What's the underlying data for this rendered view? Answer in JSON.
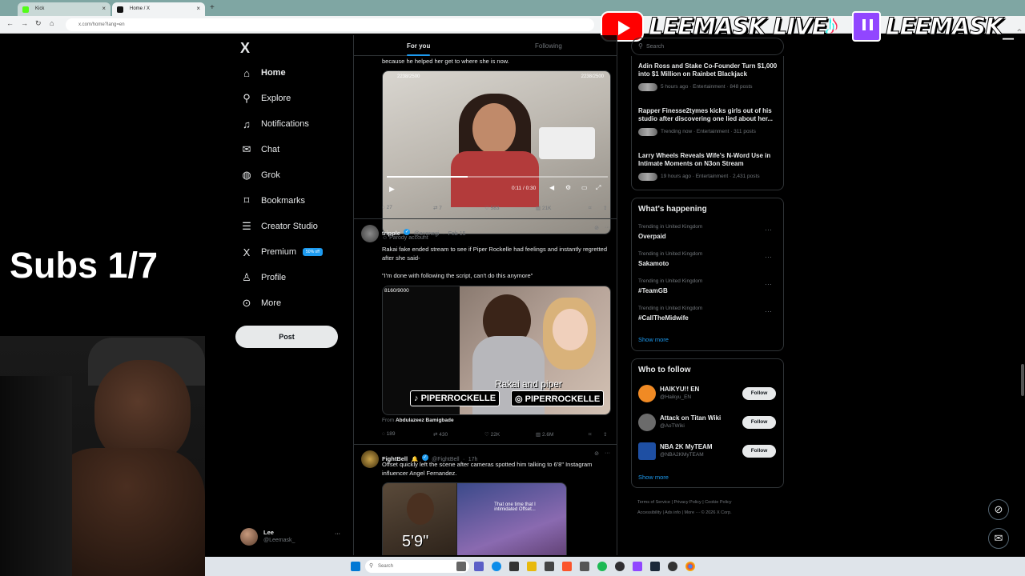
{
  "browser": {
    "tabs": [
      "Kick",
      "Home / X"
    ],
    "url": "x.com/home?lang=en"
  },
  "banner": {
    "live_text": "LEEMASK LIVE",
    "channel_text": "LEEMASK_"
  },
  "overlay": {
    "subs_text": "Subs 1/7"
  },
  "nav": {
    "logo": "X",
    "items": [
      {
        "label": "Home",
        "icon": "home-icon",
        "glyph": "⌂"
      },
      {
        "label": "Explore",
        "icon": "search-icon",
        "glyph": "⚲"
      },
      {
        "label": "Notifications",
        "icon": "bell-icon",
        "glyph": "♫"
      },
      {
        "label": "Chat",
        "icon": "mail-icon",
        "glyph": "✉"
      },
      {
        "label": "Grok",
        "icon": "grok-icon",
        "glyph": "◍"
      },
      {
        "label": "Bookmarks",
        "icon": "bookmark-icon",
        "glyph": "⌑"
      },
      {
        "label": "Creator Studio",
        "icon": "creator-studio-icon",
        "glyph": "☰"
      },
      {
        "label": "Premium",
        "icon": "x-premium-icon",
        "glyph": "X"
      },
      {
        "label": "Profile",
        "icon": "person-icon",
        "glyph": "♙"
      },
      {
        "label": "More",
        "icon": "more-circle-icon",
        "glyph": "⊙"
      }
    ],
    "premium_badge": "50% off",
    "post_label": "Post",
    "account": {
      "name": "Lee",
      "handle": "@Leemask_",
      "more": "···"
    }
  },
  "feed": {
    "tabs": [
      "For you",
      "Following"
    ],
    "post1": {
      "text": "because he helped her get to where she is now.",
      "video_counter": "2238/2500",
      "video_time": "0:11 / 0:30",
      "stats": {
        "replies": "27",
        "reposts": "7",
        "likes": "583",
        "views": "21K"
      }
    },
    "post2": {
      "name": "tripple",
      "handle": "@ayonegi",
      "date": "Feb 15",
      "parody": "Parody account",
      "text": "Rakai fake ended stream to see if Piper Rockelle had feelings and instantly regretted after she said-",
      "quote": "\"I'm done with following the script, can't do this anymore\"",
      "media_counter": "8160/9000",
      "media_caption": "Rakai and piper",
      "media_tags": [
        "PIPERROCKELLE",
        "PIPERROCKELLE"
      ],
      "from_label": "From",
      "from_name": "Abdulazeez Bamigbade",
      "stats": {
        "replies": "189",
        "reposts": "430",
        "likes": "22K",
        "views": "2.6M"
      }
    },
    "post3": {
      "name": "FightBell",
      "handle": "@FightBell",
      "date": "17h",
      "text": "Offset quickly left the scene after cameras spotted him talking to 6'8\" Instagram influencer Angel Fernandez.",
      "media_height": "5'9\"",
      "media_caption": "That one time that I intimidated Offset..."
    }
  },
  "right": {
    "search_placeholder": "Search",
    "news": [
      {
        "title": "Adin Ross and Stake Co-Founder Turn $1,000 into $1 Million on Rainbet Blackjack",
        "meta": "5 hours ago · Entertainment · 848 posts"
      },
      {
        "title": "Rapper Finesse2tymes kicks girls out of his studio after discovering one lied about her...",
        "meta": "Trending now · Entertainment · 311 posts"
      },
      {
        "title": "Larry Wheels Reveals Wife's N-Word Use in Intimate Moments on N3on Stream",
        "meta": "19 hours ago · Entertainment · 2,431 posts"
      }
    ],
    "happening_title": "What's happening",
    "trends": [
      {
        "context": "Trending in United Kingdom",
        "name": "Overpaid"
      },
      {
        "context": "Trending in United Kingdom",
        "name": "Sakamoto"
      },
      {
        "context": "Trending in United Kingdom",
        "name": "#TeamGB"
      },
      {
        "context": "Trending in United Kingdom",
        "name": "#CallTheMidwife"
      }
    ],
    "show_more": "Show more",
    "who_title": "Who to follow",
    "follows": [
      {
        "name": "HAIKYU!! EN",
        "handle": "@Haikyu_EN",
        "color": "#f08a24"
      },
      {
        "name": "Attack on Titan Wiki",
        "handle": "@AoTWiki",
        "color": "#6b6b6b"
      },
      {
        "name": "NBA 2K MyTEAM",
        "handle": "@NBA2KMyTEAM",
        "color": "#1e4fa3"
      }
    ],
    "follow_label": "Follow",
    "footer": [
      "Terms of Service",
      "Privacy Policy",
      "Cookie Policy",
      "Accessibility",
      "Ads info",
      "More ···",
      "© 2026 X Corp."
    ]
  },
  "taskbar": {
    "search": "Search"
  },
  "colors": {
    "accent": "#1d9bf0",
    "bg": "#000000",
    "border": "#2f3336",
    "muted": "#71767b"
  }
}
